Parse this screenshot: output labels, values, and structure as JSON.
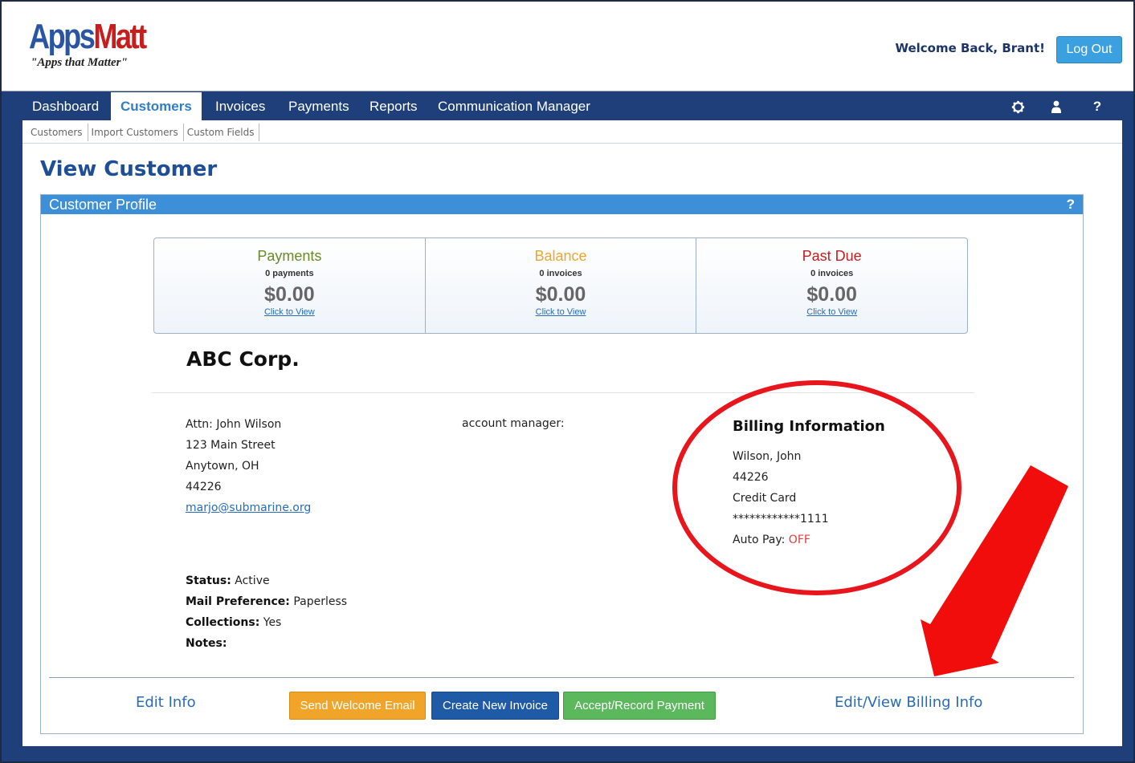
{
  "brand": {
    "logo_apps": "Apps",
    "logo_matt": "Matt",
    "tagline": "\"Apps that Matter\"",
    "colors": {
      "nav": "#1e3f7a",
      "accent": "#3d8fd8",
      "logo_blue": "#2a55a3",
      "logo_red": "#c71d1d"
    }
  },
  "header": {
    "welcome": "Welcome Back, Brant!",
    "logout_label": "Log Out"
  },
  "nav": {
    "items": [
      {
        "label": "Dashboard"
      },
      {
        "label": "Customers",
        "active": true
      },
      {
        "label": "Invoices"
      },
      {
        "label": "Payments"
      },
      {
        "label": "Reports"
      },
      {
        "label": "Communication Manager"
      }
    ],
    "icons": [
      "gear-icon",
      "user-icon",
      "help-icon"
    ],
    "help_label": "?"
  },
  "subnav": {
    "items": [
      "Customers",
      "Import Customers",
      "Custom Fields"
    ]
  },
  "page": {
    "title": "View Customer"
  },
  "panel": {
    "title": "Customer Profile",
    "help": "?"
  },
  "summary": [
    {
      "title": "Payments",
      "sub": "0 payments",
      "amount": "$0.00",
      "link": "Click to View",
      "color": "#6a8a2a"
    },
    {
      "title": "Balance",
      "sub": "0 invoices",
      "amount": "$0.00",
      "link": "Click to View",
      "color": "#f0a52a"
    },
    {
      "title": "Past Due",
      "sub": "0 invoices",
      "amount": "$0.00",
      "link": "Click to View",
      "color": "#c41f1f"
    }
  ],
  "customer": {
    "name": "ABC Corp.",
    "attn": "Attn: John Wilson",
    "street": "123 Main Street",
    "city": "Anytown, OH",
    "zip": "44226",
    "email": "marjo@submarine.org",
    "account_manager_label": "account manager:"
  },
  "billing": {
    "title": "Billing Information",
    "name": "Wilson, John",
    "zip": "44226",
    "method": "Credit Card",
    "card": "************1111",
    "autopay_label": "Auto Pay:",
    "autopay_value": "OFF"
  },
  "status": {
    "status_label": "Status:",
    "status_value": "Active",
    "mail_label": "Mail Preference:",
    "mail_value": "Paperless",
    "collections_label": "Collections:",
    "collections_value": "Yes",
    "notes_label": "Notes:"
  },
  "actions": {
    "edit_info": "Edit Info",
    "send_welcome": "Send Welcome Email",
    "create_invoice": "Create New Invoice",
    "record_payment": "Accept/Record Payment",
    "edit_billing": "Edit/View Billing Info"
  },
  "annotation": {
    "circle_color": "#e8161c",
    "arrow_color": "#f20d0d"
  }
}
